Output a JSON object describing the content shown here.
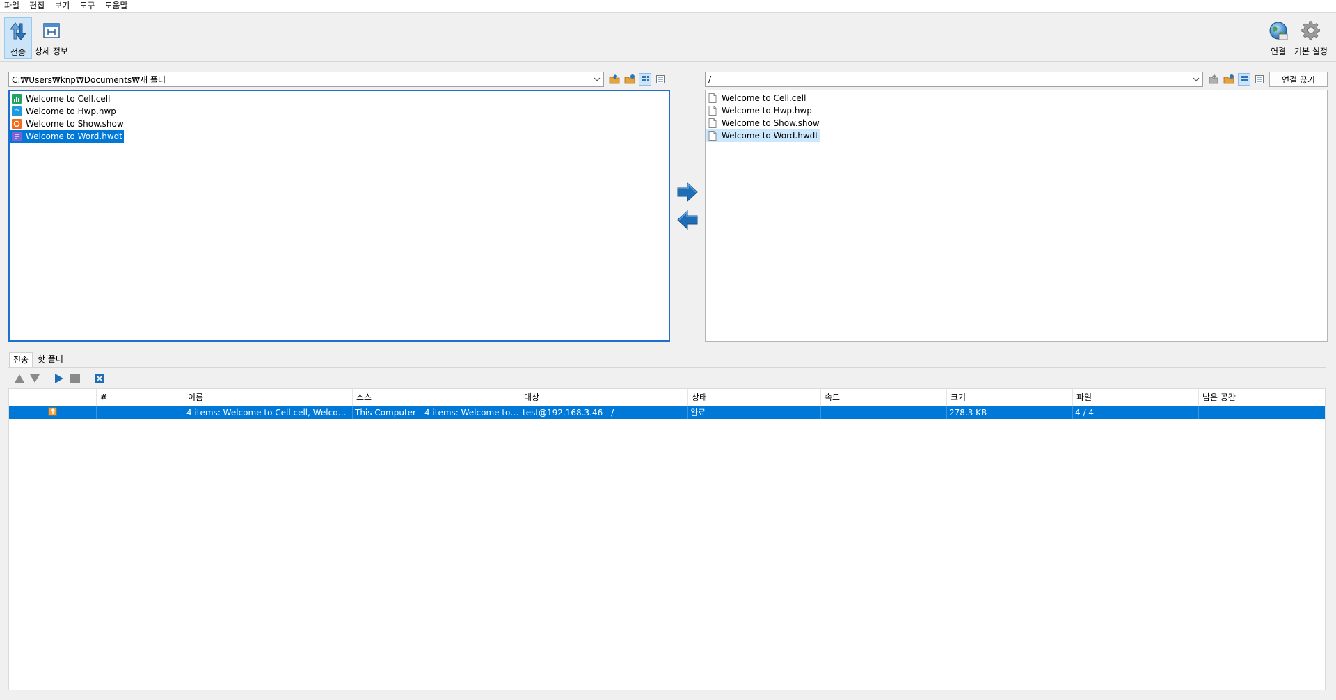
{
  "menu": [
    "파일",
    "편집",
    "보기",
    "도구",
    "도움말"
  ],
  "toolbar": {
    "transfer_label": "전송",
    "details_label": "상세 정보",
    "connect_label": "연결",
    "preferences_label": "기본 설정"
  },
  "local": {
    "path": "C:₩Users₩knp₩Documents₩새 폴더",
    "files": [
      {
        "name": "Welcome to Cell.cell",
        "icon": "cell-file-icon",
        "selected": false
      },
      {
        "name": "Welcome to Hwp.hwp",
        "icon": "hwp-file-icon",
        "selected": false
      },
      {
        "name": "Welcome to Show.show",
        "icon": "show-file-icon",
        "selected": false
      },
      {
        "name": "Welcome to Word.hwdt",
        "icon": "word-file-icon",
        "selected": true
      }
    ]
  },
  "remote": {
    "path": "/",
    "disconnect_label": "연결 끊기",
    "files": [
      {
        "name": "Welcome to Cell.cell",
        "selected": false
      },
      {
        "name": "Welcome to Hwp.hwp",
        "selected": false
      },
      {
        "name": "Welcome to Show.show",
        "selected": false
      },
      {
        "name": "Welcome to Word.hwdt",
        "selected": true
      }
    ]
  },
  "tabs": {
    "transfer": "전송",
    "hot_folder": "핫 폴더"
  },
  "transfer_table": {
    "columns": [
      "#",
      "이름",
      "소스",
      "대상",
      "상태",
      "속도",
      "크기",
      "파일",
      "남은 공간"
    ],
    "rows": [
      {
        "number": "",
        "name": "4 items: Welcome to Cell.cell, Welcome...",
        "source": "This Computer - 4 items: Welcome to C...",
        "destination": "test@192.168.3.46 - /",
        "status": "완료",
        "speed": "-",
        "size": "278.3 KB",
        "files": "4 / 4",
        "remaining": "-"
      }
    ]
  },
  "colors": {
    "accent": "#0078d7",
    "active_border": "#1f6fd1",
    "arrow_blue": "#1e6db5"
  }
}
